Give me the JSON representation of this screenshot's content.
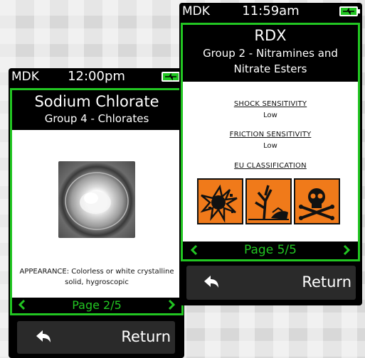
{
  "device_left": {
    "status": {
      "carrier": "MDK",
      "time": "12:00pm"
    },
    "title": "Sodium Chlorate",
    "group": "Group 4 - Chlorates",
    "appearance": "APPEARANCE: Colorless or white crystalline solid, hygroscopic",
    "page": "Page 2/5",
    "return_label": "Return"
  },
  "device_right": {
    "status": {
      "carrier": "MDK",
      "time": "11:59am"
    },
    "title": "RDX",
    "group": "Group 2 - Nitramines and Nitrate Esters",
    "shock_heading": "SHOCK SENSITIVITY",
    "shock_value": "Low",
    "friction_heading": "FRICTION SENSITIVITY",
    "friction_value": "Low",
    "eu_heading": "EU CLASSIFICATION",
    "hazard_icons": [
      "explosive-icon",
      "environmental-hazard-icon",
      "toxic-skull-icon"
    ],
    "page": "Page 5/5",
    "return_label": "Return"
  },
  "colors": {
    "accent_green": "#22c622",
    "hazard_orange": "#f07a1a",
    "button_gray": "#2a2a2a"
  }
}
